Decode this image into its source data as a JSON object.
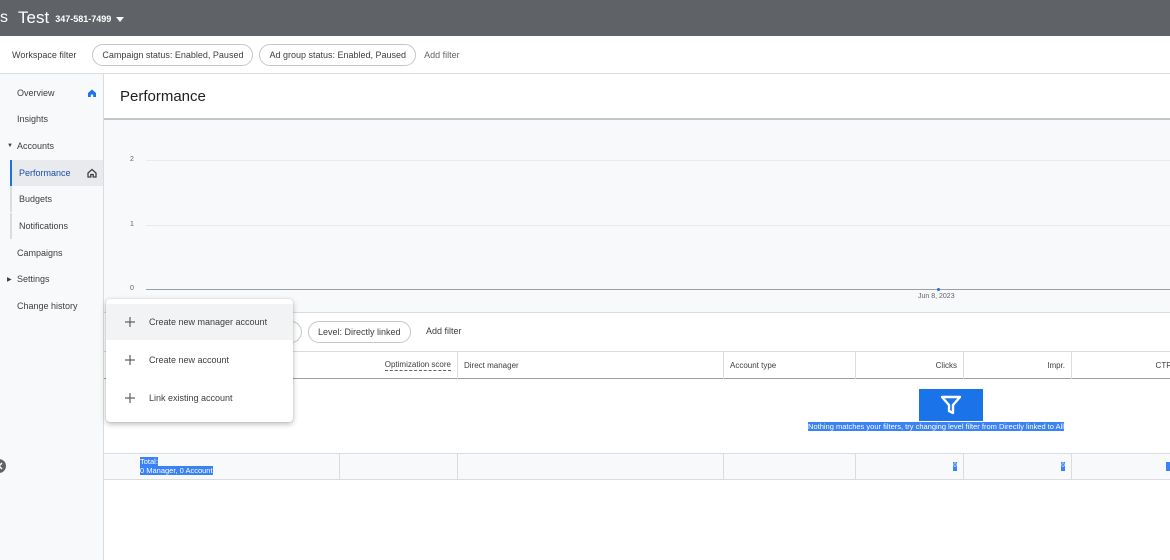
{
  "topbar": {
    "app_name_fragment": "s",
    "account_name": "Test",
    "account_id": "347-581-7499"
  },
  "workspace": {
    "label": "Workspace filter",
    "chips": [
      "Campaign status: Enabled, Paused",
      "Ad group status: Enabled, Paused"
    ],
    "add_filter": "Add filter"
  },
  "sidebar": {
    "items": [
      {
        "label": "Overview"
      },
      {
        "label": "Insights"
      },
      {
        "label": "Accounts"
      },
      {
        "label": "Performance"
      },
      {
        "label": "Budgets"
      },
      {
        "label": "Notifications"
      },
      {
        "label": "Campaigns"
      },
      {
        "label": "Settings"
      },
      {
        "label": "Change history"
      }
    ],
    "icons": [
      "home-icon",
      "chevron-right-icon"
    ]
  },
  "main": {
    "title": "Performance"
  },
  "chart_data": {
    "type": "line",
    "x": [
      "Jun 8, 2023"
    ],
    "series": [
      {
        "values": [
          0
        ]
      }
    ],
    "yticks": [
      "2",
      "1",
      "0"
    ],
    "xtick_labels": [
      "Jun 8, 2023"
    ],
    "ylim": [
      0,
      2
    ],
    "grid": true
  },
  "table": {
    "filter_chip": "Level: Directly linked",
    "add_filter": "Add filter",
    "columns": [
      "Optimization score",
      "Direct manager",
      "Account type",
      "Clicks",
      "Impr.",
      "CTR"
    ],
    "empty_message": "Nothing matches your filters, try changing level filter from Directly linked to All",
    "total_label": "Total:",
    "total_sub": "0 Manager, 0 Account",
    "total_values": [
      "0",
      "0"
    ]
  },
  "dropdown": {
    "items": [
      {
        "label": "Create new manager account"
      },
      {
        "label": "Create new account"
      },
      {
        "label": "Link existing account"
      }
    ]
  },
  "colors": {
    "topbar": "#5f6368",
    "accent": "#1a73e8",
    "selection": "#3b82f6"
  }
}
